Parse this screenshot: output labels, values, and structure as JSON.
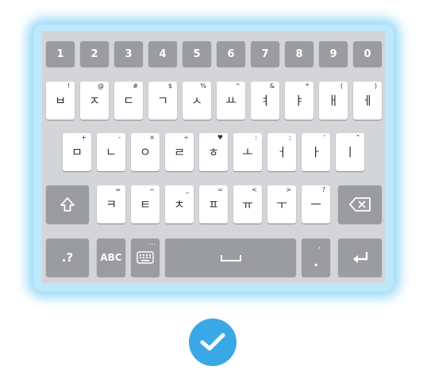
{
  "colors": {
    "glow": "#7ccdf5",
    "keyboard_bg": "#d4d5d8",
    "light_key": "#ffffff",
    "dark_key": "#9a9c9f",
    "check": "#3aa8e6"
  },
  "keyboard": {
    "number_row": [
      "1",
      "2",
      "3",
      "4",
      "5",
      "6",
      "7",
      "8",
      "9",
      "0"
    ],
    "row1": [
      {
        "main": "ㅂ",
        "sub": "!"
      },
      {
        "main": "ㅈ",
        "sub": "@"
      },
      {
        "main": "ㄷ",
        "sub": "#"
      },
      {
        "main": "ㄱ",
        "sub": "$"
      },
      {
        "main": "ㅅ",
        "sub": "%"
      },
      {
        "main": "ㅛ",
        "sub": "^"
      },
      {
        "main": "ㅕ",
        "sub": "&"
      },
      {
        "main": "ㅑ",
        "sub": "*"
      },
      {
        "main": "ㅐ",
        "sub": "("
      },
      {
        "main": "ㅔ",
        "sub": ")"
      }
    ],
    "row2": [
      {
        "main": "ㅁ",
        "sub": "+"
      },
      {
        "main": "ㄴ",
        "sub": "-"
      },
      {
        "main": "ㅇ",
        "sub": "×"
      },
      {
        "main": "ㄹ",
        "sub": "÷"
      },
      {
        "main": "ㅎ",
        "sub": "♥"
      },
      {
        "main": "ㅗ",
        "sub": ":"
      },
      {
        "main": "ㅓ",
        "sub": ";"
      },
      {
        "main": "ㅏ",
        "sub": "'"
      },
      {
        "main": "ㅣ",
        "sub": "\""
      }
    ],
    "row3": [
      {
        "main": "ㅋ",
        "sub": "∞"
      },
      {
        "main": "ㅌ",
        "sub": "~"
      },
      {
        "main": "ㅊ",
        "sub": "_"
      },
      {
        "main": "ㅍ",
        "sub": "="
      },
      {
        "main": "ㅠ",
        "sub": "<"
      },
      {
        "main": "ㅜ",
        "sub": ">"
      },
      {
        "main": "ㅡ",
        "sub": "?"
      }
    ],
    "bottom": {
      "sym_label": ".?",
      "abc_label": "ABC",
      "emoji_keyboard_dots": "...",
      "period_label": ".",
      "period_sub": ","
    },
    "icons": {
      "shift": "shift-icon",
      "backspace": "backspace-icon",
      "space": "space-icon",
      "enter": "enter-icon",
      "keyboard": "keyboard-icon",
      "status": "checkmark-icon"
    }
  }
}
